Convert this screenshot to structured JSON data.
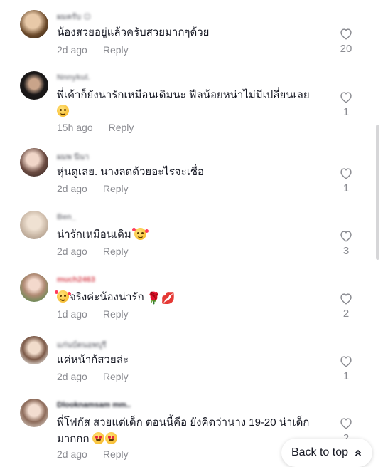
{
  "comments": [
    {
      "username": "ผมครับ 😊",
      "text": "น้องสวยอยู่แล้วครับสวยมากๆด้วย",
      "time": "2d ago",
      "reply": "Reply",
      "likes": "20"
    },
    {
      "username": "Nnnykul.",
      "text": "พี่เค้าก็ยังน่ารักเหมือนเดิมนะ ฟีลน้อยหน่าไม่มีเปลี่ยนเลย",
      "time": "15h ago",
      "reply": "Reply",
      "likes": "1"
    },
    {
      "username": "ผมพ นีนา",
      "text": "หุ่นดูเลย. นางลดด้วยอะไรจะเชื่อ",
      "time": "2d ago",
      "reply": "Reply",
      "likes": "1"
    },
    {
      "username": "Ben_",
      "text": "น่ารักเหมือนเดิม",
      "time": "2d ago",
      "reply": "Reply",
      "likes": "3"
    },
    {
      "username": "much2463",
      "text": "จริงค่ะน้องน่ารัก",
      "time": "1d ago",
      "reply": "Reply",
      "likes": "2"
    },
    {
      "username": "แก่นบ์ตนอพบุรี",
      "text": "แค่หน้าก้สวยล่ะ",
      "time": "2d ago",
      "reply": "Reply",
      "likes": "1"
    },
    {
      "username": "Dlooknamsam mm..",
      "text": "พี่โฟกัส สวยแต่เด็ก ตอนนี้คือ ยังคิดว่านาง 19-20 น่าเด็กมากกก",
      "time": "2d ago",
      "reply": "Reply",
      "likes": "2"
    }
  ],
  "back_to_top": {
    "label": "Back to top",
    "icon": "double-chevron-up-icon"
  },
  "colors": {
    "text": "#161823",
    "muted": "#8a8b91",
    "background": "#ffffff"
  }
}
